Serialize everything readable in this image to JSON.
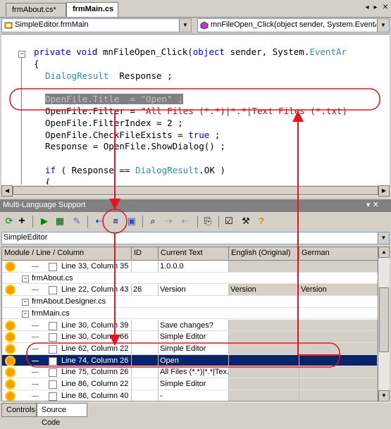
{
  "tabs": [
    "frmAbout.cs*",
    "frmMain.cs"
  ],
  "class_combo": "SimpleEditor.frmMain",
  "member_combo": "mnFileOpen_Click(object sender, System.EventA",
  "code_lines": [
    {
      "parts": [
        [
          "kw",
          "private void "
        ],
        [
          "",
          "mnFileOpen_Click("
        ],
        [
          "kw",
          "object "
        ],
        [
          "",
          "sender, System."
        ],
        [
          "ty",
          "EventAr"
        ]
      ]
    },
    {
      "parts": [
        [
          "",
          "{"
        ]
      ]
    },
    {
      "parts": [
        [
          "ty",
          "DialogResult"
        ],
        [
          "",
          "  Response ;"
        ]
      ]
    },
    {
      "parts": [
        [
          "",
          ""
        ]
      ]
    },
    {
      "parts": [
        [
          "sel",
          "OpenFile.Title  = \"Open\" ;"
        ]
      ]
    },
    {
      "parts": [
        [
          "",
          "OpenFile.Filter = "
        ],
        [
          "str",
          "\"All Files (*.*)|*.*|Text Files (*.txt)"
        ]
      ]
    },
    {
      "parts": [
        [
          "",
          "OpenFile.FilterIndex = 2 ;"
        ]
      ]
    },
    {
      "parts": [
        [
          "",
          "OpenFile.CheckFileExists = "
        ],
        [
          "kw",
          "true"
        ],
        [
          "",
          " ;"
        ]
      ]
    },
    {
      "parts": [
        [
          "",
          "Response = OpenFile.ShowDialog() ;"
        ]
      ]
    },
    {
      "parts": [
        [
          "",
          ""
        ]
      ]
    },
    {
      "parts": [
        [
          "kw",
          "if"
        ],
        [
          "",
          " ( Response == "
        ],
        [
          "ty",
          "DialogResult"
        ],
        [
          "",
          ".OK )"
        ]
      ]
    },
    {
      "parts": [
        [
          "",
          "{"
        ]
      ]
    }
  ],
  "panel_title": "Multi-Language Support",
  "panel_controls": "▾ ✕",
  "filter_combo": "SimpleEditor",
  "columns": [
    "Module / Line / Column",
    "ID",
    "Current Text",
    "English (Original)",
    "German"
  ],
  "rows": [
    {
      "type": "item",
      "indent": 52,
      "sun": true,
      "label": "Line 33, Column 35",
      "id": "",
      "text": "1.0.0.0",
      "en": "",
      "de": ""
    },
    {
      "type": "group",
      "indent": 28,
      "label": "frmAbout.cs"
    },
    {
      "type": "item",
      "indent": 52,
      "sun": true,
      "label": "Line 22, Column 43",
      "id": "26",
      "text": "Version",
      "en": "Version",
      "de": "Version"
    },
    {
      "type": "group",
      "indent": 28,
      "label": "frmAbout.Designer.cs"
    },
    {
      "type": "group",
      "indent": 28,
      "label": "frmMain.cs"
    },
    {
      "type": "item",
      "indent": 52,
      "sun": true,
      "label": "Line 30, Column 39",
      "id": "",
      "text": "Save changes?",
      "en": "",
      "de": ""
    },
    {
      "type": "item",
      "indent": 52,
      "sun": true,
      "label": "Line 30, Column 66",
      "id": "",
      "text": "Simple Editor",
      "en": "",
      "de": ""
    },
    {
      "type": "item",
      "indent": 52,
      "sun": true,
      "label": "Line 62, Column 22",
      "id": "",
      "text": "Simple Editor",
      "en": "",
      "de": ""
    },
    {
      "type": "item",
      "indent": 52,
      "sun": true,
      "selected": true,
      "label": "Line 74, Column 26",
      "id": "",
      "text": "Open",
      "en": "",
      "de": ""
    },
    {
      "type": "item",
      "indent": 52,
      "sun": true,
      "label": "Line 75, Column 26",
      "id": "",
      "text": "All Files (*.*)|*.*|Tex...",
      "en": "",
      "de": ""
    },
    {
      "type": "item",
      "indent": 52,
      "sun": true,
      "label": "Line 86, Column 22",
      "id": "",
      "text": "Simple Editor",
      "en": "",
      "de": ""
    },
    {
      "type": "item",
      "indent": 52,
      "sun": true,
      "label": "Line 86, Column 40",
      "id": "",
      "text": "-",
      "en": "",
      "de": ""
    }
  ],
  "bottom_tabs": [
    "Controls",
    "Source Code"
  ],
  "accent_color": "#e8141e"
}
